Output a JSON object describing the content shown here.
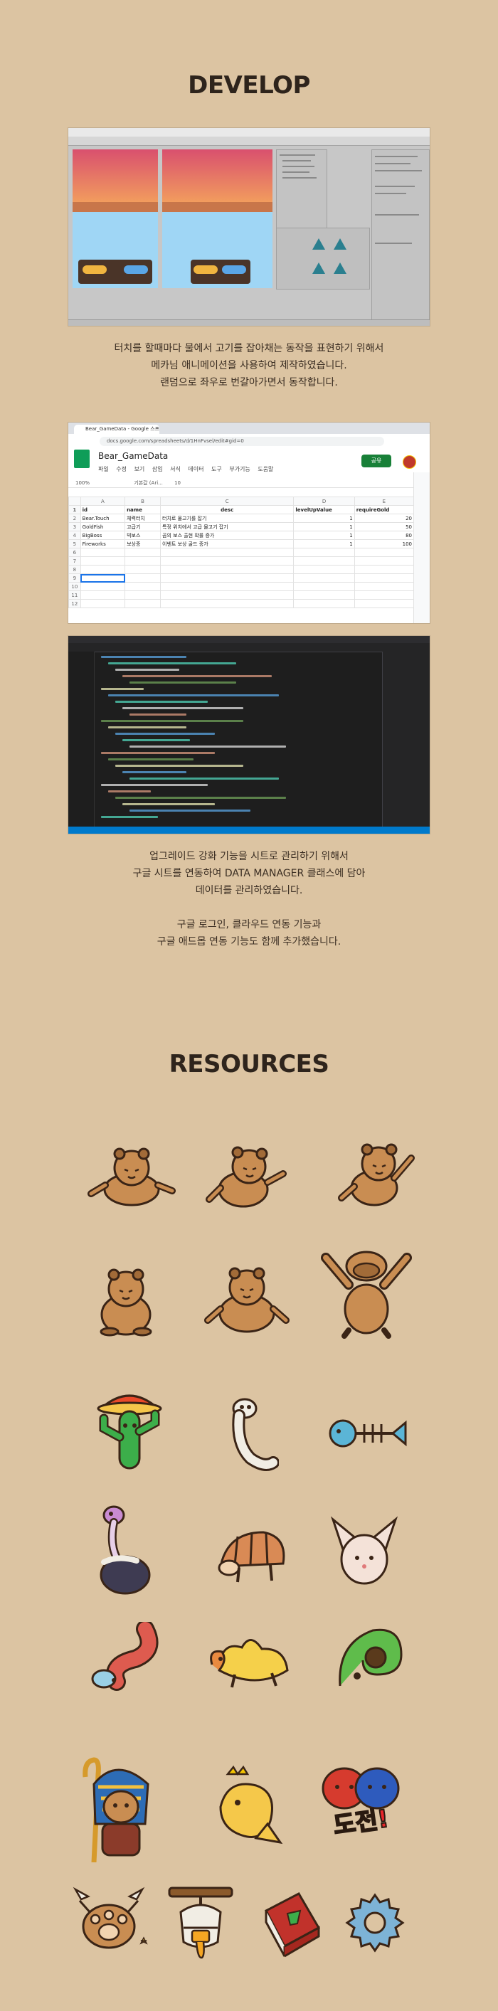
{
  "develop": {
    "title": "DEVELOP",
    "caption1": [
      "터치를 할때마다 물에서 고기를 잡아채는 동작을 표현하기 위해서",
      "메카님 애니메이션을 사용하여 제작하였습니다.",
      "랜덤으로 좌우로 번갈아가면서 동작합니다."
    ],
    "caption2": [
      "업그레이드 강화 기능을 시트로 관리하기 위해서",
      "구글 시트를 연동하여 DATA MANAGER 클래스에 담아",
      "데이터를 관리하였습니다."
    ],
    "caption3": [
      "구글 로그인, 클라우드 연동 기능과",
      "구글 애드몹 연동 기능도 함께 추가했습니다."
    ]
  },
  "sheet": {
    "tab_title": "Bear_GameData - Google 스프",
    "url": "docs.google.com/spreadsheets/d/1HnFvsel/edit#gid=0",
    "doc_title": "Bear_GameData",
    "menu": [
      "파일",
      "수정",
      "보기",
      "삽입",
      "서식",
      "데이터",
      "도구",
      "부가기능",
      "도움말"
    ],
    "share_label": "공유",
    "zoom": "100%",
    "font": "기본값 (Ari...",
    "font_size": "10",
    "columns": [
      "A",
      "B",
      "C",
      "D",
      "E"
    ],
    "headers": [
      "id",
      "name",
      "desc",
      "levelUpValue",
      "requireGold"
    ],
    "rows": [
      [
        "Bear.Touch",
        "체력터치",
        "터치로 물고기를 잡기",
        "1",
        "20"
      ],
      [
        "GoldFish",
        "고급기",
        "특정 위치에서 고급 물고기 잡기",
        "1",
        "50"
      ],
      [
        "BigBoss",
        "빅보스",
        "곰의 보스 출현 확률 증가",
        "1",
        "80"
      ],
      [
        "Fireworks",
        "보상증",
        "이벤트 보상 골드 증가",
        "1",
        "100"
      ]
    ],
    "row_numbers": [
      "1",
      "2",
      "3",
      "4",
      "5",
      "6",
      "7",
      "8",
      "9",
      "10",
      "11",
      "12"
    ]
  },
  "resources": {
    "title": "RESOURCES",
    "badge_text": "도전!"
  },
  "colors": {
    "background": "#dcc4a2",
    "bear": "#c98d52",
    "bear_dark": "#a26b38",
    "outline": "#3a2416"
  }
}
